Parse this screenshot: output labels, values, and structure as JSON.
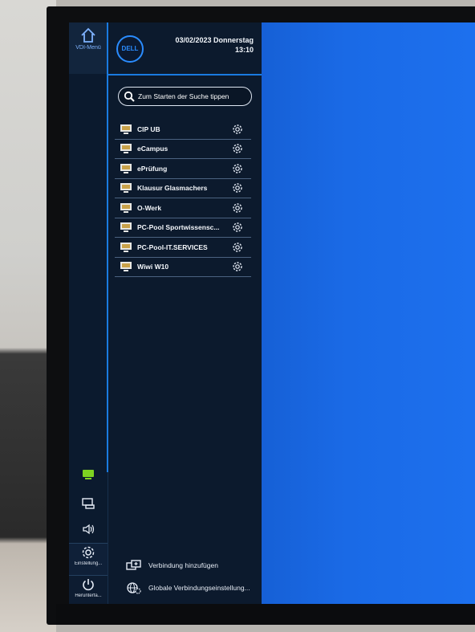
{
  "rail": {
    "home_label": "VDI-Menü",
    "settings_label": "Einstellung...",
    "shutdown_label": "Herunterfa..."
  },
  "header": {
    "logo_text": "DELL",
    "date": "03/02/2023 Donnerstag",
    "time": "13:10"
  },
  "search": {
    "placeholder": "Zum Starten der Suche tippen"
  },
  "connections": [
    {
      "label": "CIP UB"
    },
    {
      "label": "eCampus"
    },
    {
      "label": "ePrüfung"
    },
    {
      "label": "Klausur Glasmachers"
    },
    {
      "label": "O-Werk"
    },
    {
      "label": "PC-Pool Sportwissensc..."
    },
    {
      "label": "PC-Pool-IT.SERVICES"
    },
    {
      "label": "Wiwi W10"
    }
  ],
  "actions": {
    "add_connection": "Verbindung hinzufügen",
    "global_settings": "Globale Verbindungseinstellung..."
  },
  "colors": {
    "accent": "#1a7be0",
    "desktop": "#1a6ae6",
    "panel": "#0c1a2d",
    "active_green": "#7ed321"
  }
}
